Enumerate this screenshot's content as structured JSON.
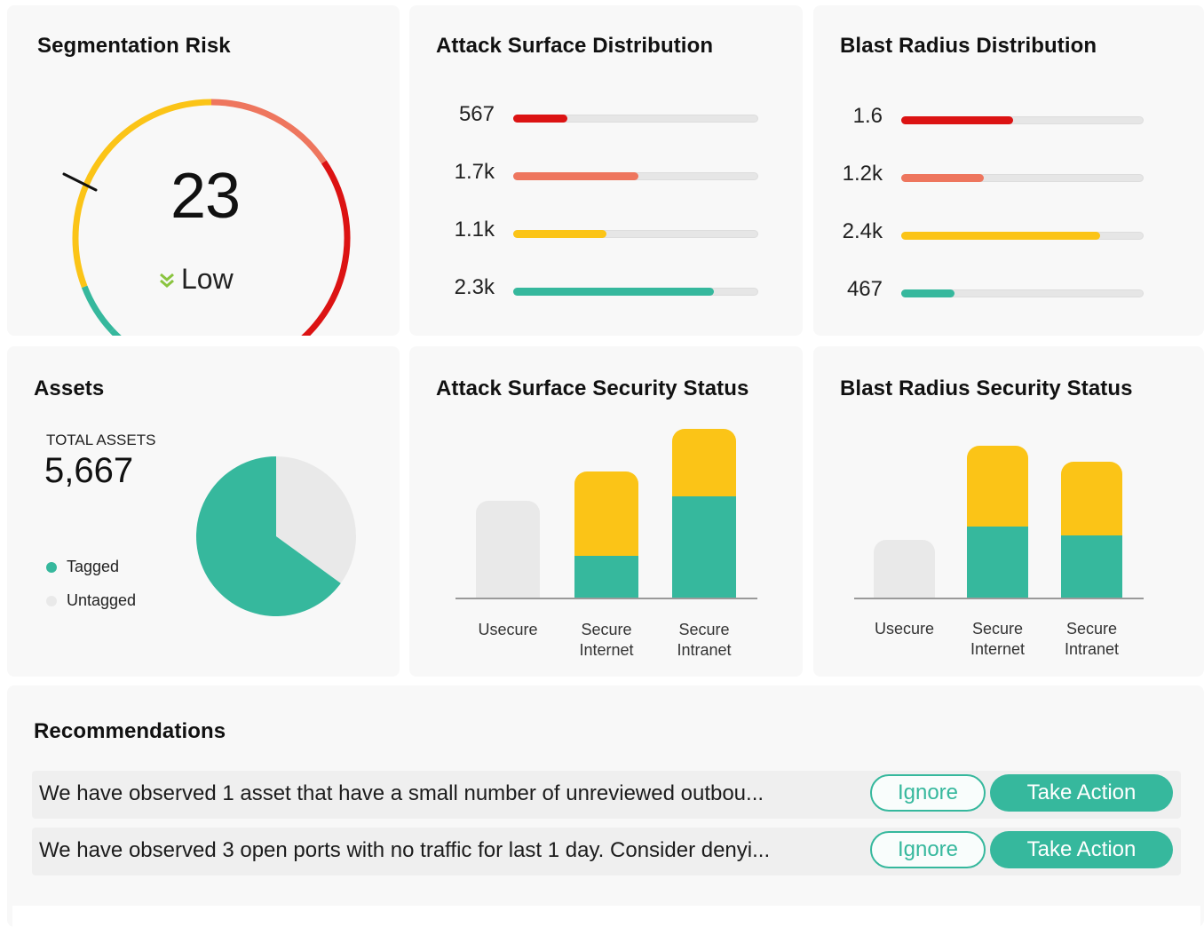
{
  "colors": {
    "teal": "#36b89d",
    "yellow": "#fbc417",
    "salmon": "#ee765e",
    "red": "#dc1313",
    "gray": "#e9e9e9"
  },
  "segmentation_risk": {
    "title": "Segmentation Risk",
    "score": "23",
    "level_label": "Low",
    "level_icon": "double-chevron-down-icon"
  },
  "attack_surface_distribution": {
    "title": "Attack Surface Distribution",
    "rows": [
      {
        "label": "567",
        "fraction": 0.22,
        "color": "#dc1313"
      },
      {
        "label": "1.7k",
        "fraction": 0.51,
        "color": "#ee765e"
      },
      {
        "label": "1.1k",
        "fraction": 0.38,
        "color": "#fbc417"
      },
      {
        "label": "2.3k",
        "fraction": 0.82,
        "color": "#36b89d"
      }
    ]
  },
  "blast_radius_distribution": {
    "title": "Blast Radius Distribution",
    "rows": [
      {
        "label": "1.6",
        "fraction": 0.46,
        "color": "#dc1313"
      },
      {
        "label": "1.2k",
        "fraction": 0.34,
        "color": "#ee765e"
      },
      {
        "label": "2.4k",
        "fraction": 0.82,
        "color": "#fbc417"
      },
      {
        "label": "467",
        "fraction": 0.22,
        "color": "#36b89d"
      }
    ]
  },
  "assets": {
    "title": "Assets",
    "total_label": "TOTAL ASSETS",
    "total_value": "5,667",
    "legend": [
      {
        "label": "Tagged",
        "color": "#36b89d"
      },
      {
        "label": "Untagged",
        "color": "#e9e9e9"
      }
    ]
  },
  "attack_surface_security_status": {
    "title": "Attack Surface Security Status"
  },
  "blast_radius_security_status": {
    "title": "Blast Radius Security Status"
  },
  "recommendations": {
    "title": "Recommendations",
    "items": [
      {
        "text": "We have observed 1 asset that have a small number of unreviewed outbou...",
        "ignore_label": "Ignore",
        "action_label": "Take Action"
      },
      {
        "text": "We have observed 3 open ports with no traffic for last 1 day. Consider denyi...",
        "ignore_label": "Ignore",
        "action_label": "Take Action"
      }
    ]
  },
  "chart_data": [
    {
      "type": "pie",
      "title": "Assets",
      "categories": [
        "Tagged",
        "Untagged"
      ],
      "values": [
        65,
        35
      ],
      "colors": [
        "#36b89d",
        "#e9e9e9"
      ]
    },
    {
      "type": "bar",
      "stacked": true,
      "title": "Attack Surface Security Status",
      "categories": [
        "Usecure",
        "Secure\nInternet",
        "Secure\nIntranet"
      ],
      "series": [
        {
          "values": [
            0,
            47,
            114
          ],
          "color": "#36b89d"
        },
        {
          "values": [
            0,
            95,
            76
          ],
          "color": "#fbc417"
        },
        {
          "values": [
            109,
            0,
            0
          ],
          "color": "#e9e9e9"
        }
      ],
      "ylim": [
        0,
        190
      ],
      "grid": false
    },
    {
      "type": "bar",
      "stacked": true,
      "title": "Blast Radius Security Status",
      "categories": [
        "Usecure",
        "Secure\nInternet",
        "Secure\nIntranet"
      ],
      "series": [
        {
          "values": [
            0,
            80,
            70
          ],
          "color": "#36b89d"
        },
        {
          "values": [
            0,
            91,
            83
          ],
          "color": "#fbc417"
        },
        {
          "values": [
            65,
            0,
            0
          ],
          "color": "#e9e9e9"
        }
      ],
      "ylim": [
        0,
        190
      ],
      "grid": false
    }
  ]
}
